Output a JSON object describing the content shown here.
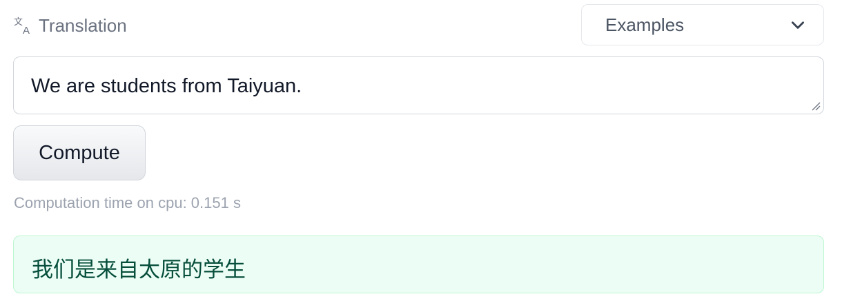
{
  "header": {
    "task_icon": "translation-icon",
    "task_title": "Translation"
  },
  "examples": {
    "label": "Examples",
    "icon": "chevron-down-icon"
  },
  "input": {
    "value": "We are students from Taiyuan."
  },
  "compute_button": {
    "label": "Compute"
  },
  "timing": {
    "text": "Computation time on cpu: 0.151 s"
  },
  "output": {
    "text": "我们是来自太原的学生"
  },
  "colors": {
    "output_background": "#ecfdf5",
    "output_border": "#bbf7d0",
    "output_text": "#064e3b",
    "muted_text": "#6b7280"
  }
}
